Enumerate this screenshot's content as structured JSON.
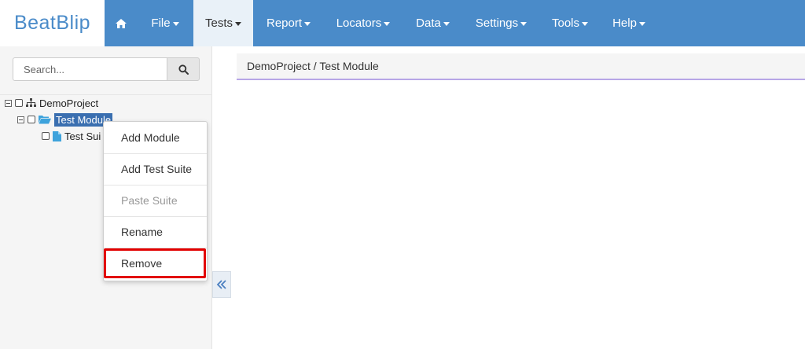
{
  "brand": {
    "logo_text": "BeatBlip",
    "color": "#4a8bc9"
  },
  "navbar": {
    "background": "#4a8bc9",
    "home_icon": "home-icon",
    "items": [
      {
        "label": "File",
        "has_caret": true
      },
      {
        "label": "Tests",
        "has_caret": true,
        "active": true
      },
      {
        "label": "Report",
        "has_caret": true
      },
      {
        "label": "Locators",
        "has_caret": true
      },
      {
        "label": "Data",
        "has_caret": true
      },
      {
        "label": "Settings",
        "has_caret": true
      },
      {
        "label": "Tools",
        "has_caret": true
      },
      {
        "label": "Help",
        "has_caret": true
      }
    ]
  },
  "sidebar": {
    "search": {
      "placeholder": "Search...",
      "value": "",
      "button_icon": "search-icon"
    },
    "tree": [
      {
        "label": "DemoProject",
        "icon": "sitemap-icon",
        "expanded": true,
        "checked": false
      },
      {
        "label": "Test Module",
        "icon": "folder-open-icon",
        "expanded": true,
        "checked": false,
        "selected": true
      },
      {
        "label": "Test Suite",
        "visible_label": "Test Sui",
        "icon": "file-icon",
        "checked": false
      }
    ],
    "collapse_icon": "double-chevron-left-icon"
  },
  "context_menu": {
    "items": [
      {
        "label": "Add Module",
        "enabled": true
      },
      {
        "label": "Add Test Suite",
        "enabled": true
      },
      {
        "label": "Paste Suite",
        "enabled": false
      },
      {
        "label": "Rename",
        "enabled": true
      },
      {
        "label": "Remove",
        "enabled": true,
        "highlighted": true
      }
    ],
    "highlight_color": "#e20000"
  },
  "main": {
    "breadcrumb": "DemoProject / Test Module"
  }
}
